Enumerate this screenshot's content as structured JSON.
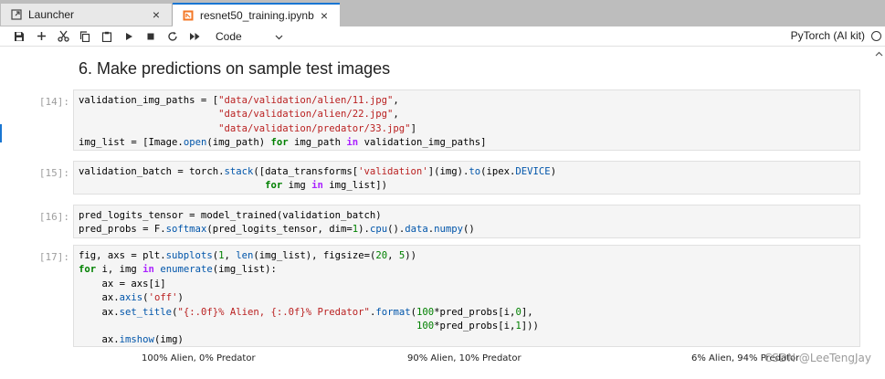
{
  "tabs": [
    {
      "label": "Launcher",
      "icon": "launcher-icon",
      "close": "×"
    },
    {
      "label": "resnet50_training.ipynb",
      "icon": "notebook-icon",
      "close": "×"
    }
  ],
  "toolbar": {
    "buttons": [
      "save-icon",
      "add-icon",
      "cut-icon",
      "copy-icon",
      "paste-icon",
      "run-icon",
      "stop-icon",
      "restart-icon",
      "fast-forward-icon"
    ],
    "cell_type": "Code",
    "kernel_name": "PyTorch (AI kit)"
  },
  "notebook": {
    "heading": "6. Make predictions on sample test images",
    "cells": [
      {
        "prompt": "[14]:"
      },
      {
        "prompt": "[15]:"
      },
      {
        "prompt": "[16]:"
      },
      {
        "prompt": "[17]:"
      }
    ],
    "output_titles": [
      "100% Alien, 0% Predator",
      "90% Alien, 10% Predator",
      "6% Alien, 94% Predator"
    ],
    "watermark": "CSDN @LeeTengJay"
  },
  "colors": {
    "accent": "#1976d2",
    "keyword": "#008000",
    "string": "#ba2121",
    "tab_bar": "#bdbdbd"
  }
}
